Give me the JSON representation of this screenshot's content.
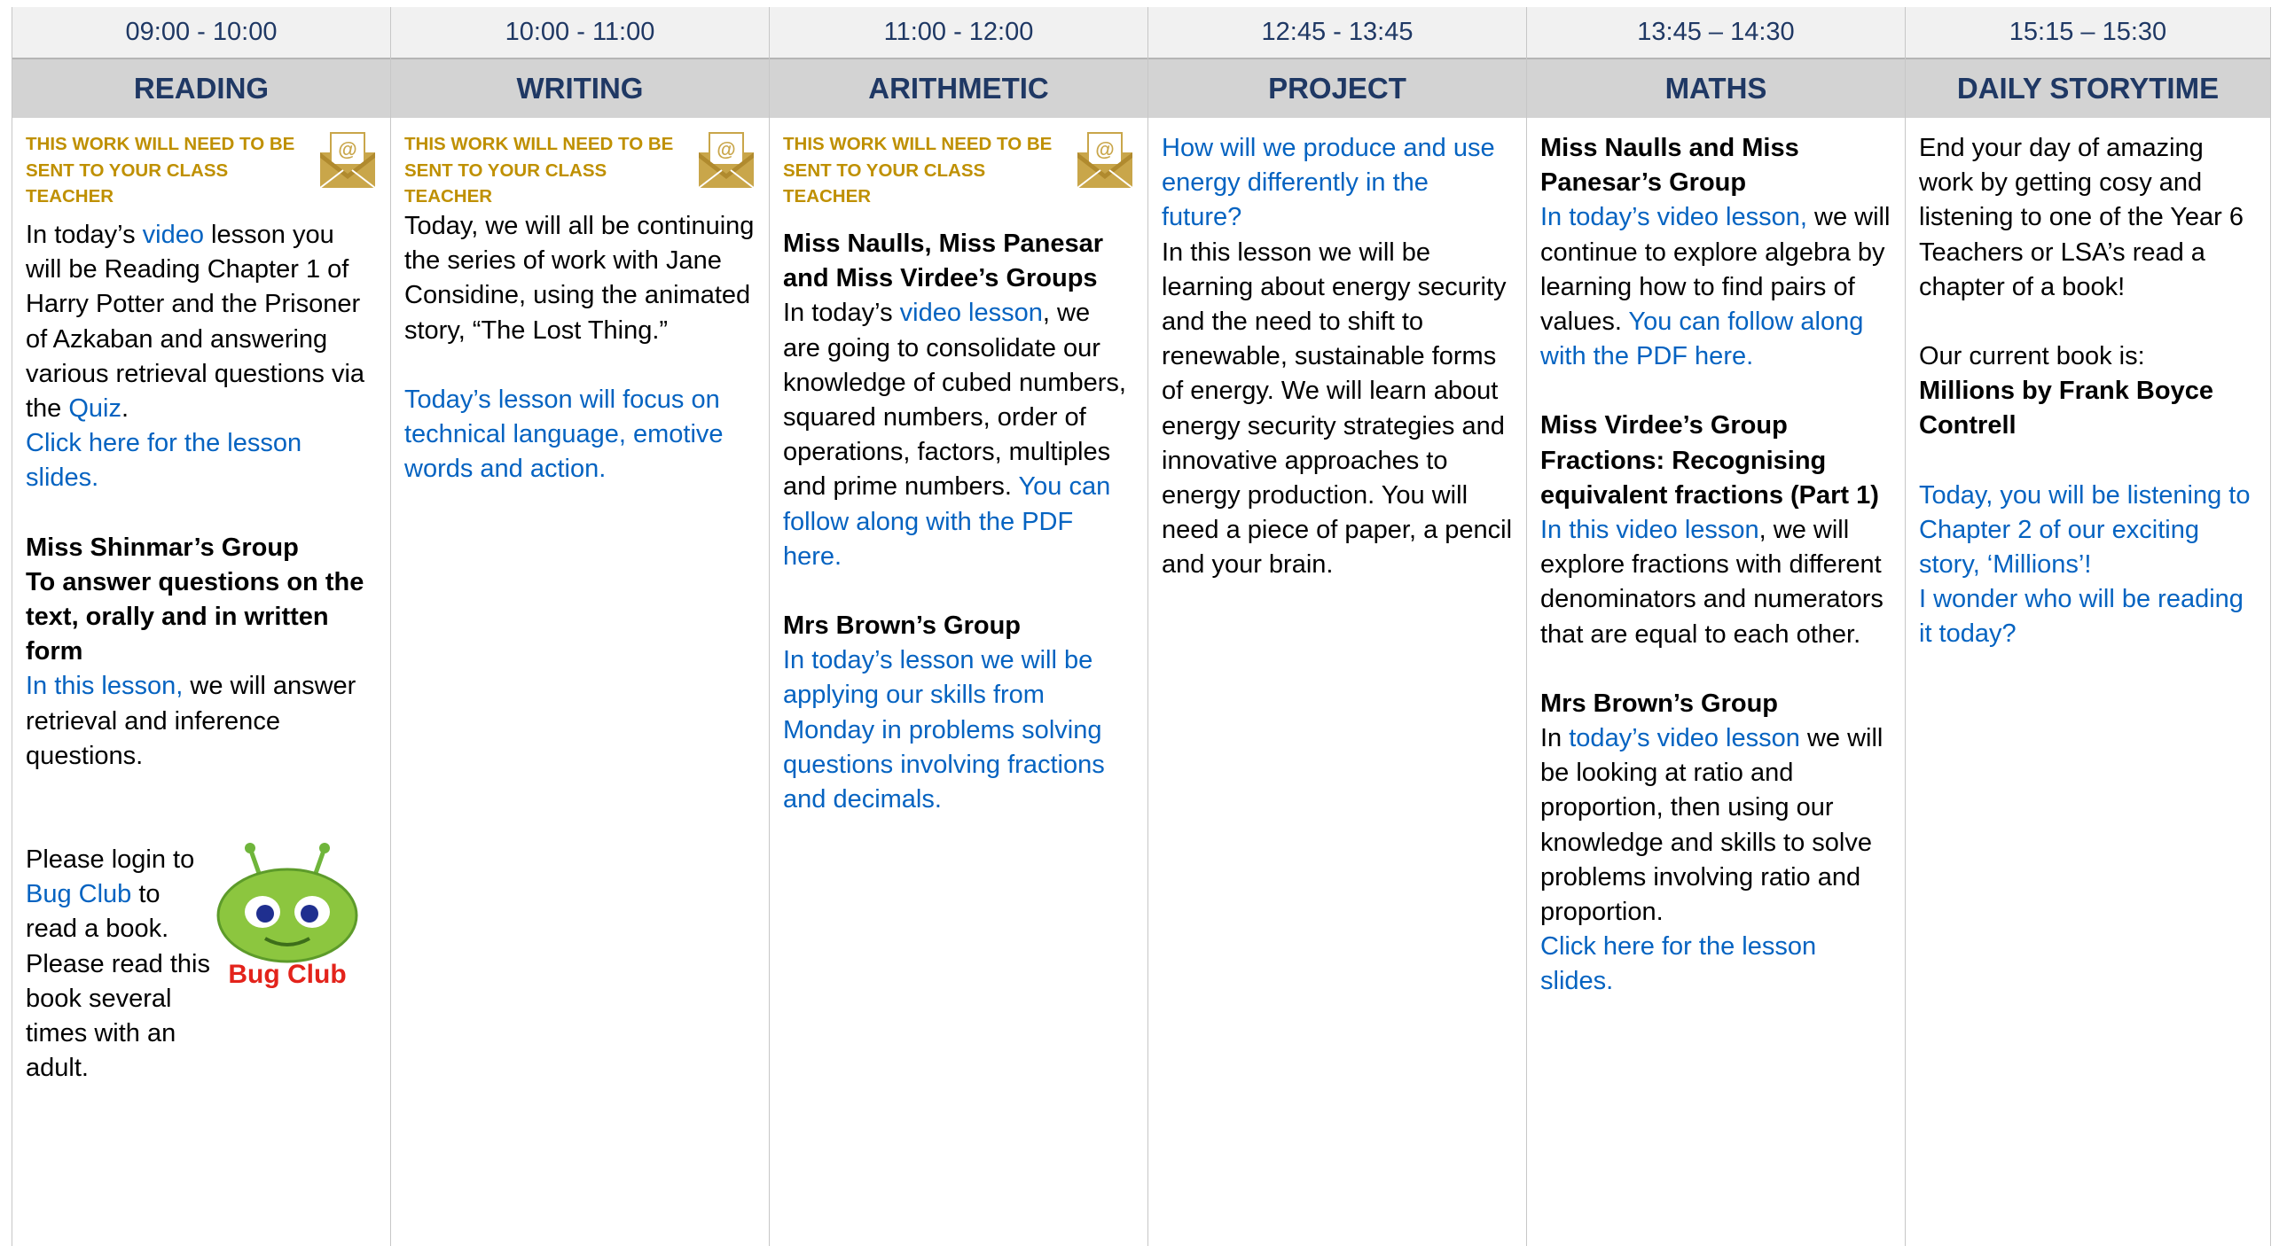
{
  "colors": {
    "header_text": "#1f3864",
    "notice": "#bf9000",
    "link": "#0563c1",
    "subject_bg": "#d3d3d3"
  },
  "icons": {
    "envelope": "email-envelope-icon",
    "bug_club": "bug-club-logo"
  },
  "columns": [
    {
      "time": "09:00 - 10:00",
      "subject": "READING",
      "notice": "THIS WORK WILL NEED TO BE SENT TO YOUR CLASS TEACHER",
      "p1_a": "In today’s ",
      "p1_link": "video",
      "p1_b": " lesson you will be Reading Chapter 1 of Harry Potter and the Prisoner of Azkaban and answering various retrieval questions via the ",
      "p1_link2": "Quiz",
      "p1_c": ".",
      "p2_link": "Click here for the lesson slides.",
      "group_heading": "Miss Shinmar’s Group",
      "group_objective": "To answer questions on the text, orally and in written form",
      "p3_link": "In this lesson,",
      "p3_b": " we will answer retrieval and inference questions.",
      "bug_a": "Please login to ",
      "bug_link": "Bug Club",
      "bug_b": " to read a book. Please read this book several times with an adult.",
      "bug_logo_text": "Bug Club"
    },
    {
      "time": "10:00 - 11:00",
      "subject": "WRITING",
      "notice": "THIS WORK WILL NEED TO BE SENT TO YOUR CLASS TEACHER",
      "p1": "Today, we will all be continuing the series of work with Jane Considine, using the animated story, “The Lost Thing.”",
      "p2_link": "Today’s lesson will focus on technical language, emotive words and action."
    },
    {
      "time": "11:00 - 12:00",
      "subject": "ARITHMETIC",
      "notice": "THIS WORK WILL NEED TO BE SENT TO YOUR CLASS TEACHER",
      "group1_heading": "Miss Naulls, Miss Panesar and Miss Virdee’s Groups",
      "p1_a": "In today’s ",
      "p1_link": "video lesson",
      "p1_b": ", we are going to consolidate our knowledge of cubed numbers, squared numbers, order of operations, factors, multiples and prime numbers.",
      "p1_link2": "You can follow along with the PDF here.",
      "group2_heading": "Mrs Brown’s Group",
      "p2_link": "In today’s lesson we will be applying our skills from Monday in problems solving questions involving fractions and decimals."
    },
    {
      "time": "12:45 - 13:45",
      "subject": "PROJECT",
      "p1_link": "How will we produce and use energy differently in the future?",
      "p1_b": "In this lesson we will be learning about energy security and the need to shift to renewable, sustainable forms of energy. We will learn about energy security strategies and innovative approaches to energy production. You will need a piece of paper, a pencil and your brain."
    },
    {
      "time": "13:45 – 14:30",
      "subject": "MATHS",
      "group1_heading": "Miss Naulls and Miss Panesar’s Group",
      "p1_link": "In today’s video lesson,",
      "p1_b": " we will continue to explore algebra by learning how to find pairs of values. ",
      "p1_link2": "You can follow along with the PDF here.",
      "group2_heading": "Miss Virdee’s Group",
      "group2_title": "Fractions: Recognising equivalent fractions (Part 1)",
      "p2_link": "In this video lesson",
      "p2_b": ", we will explore fractions with different denominators and numerators that are equal to each other.",
      "group3_heading": "Mrs Brown’s Group",
      "p3_a": "In ",
      "p3_link": "today’s video lesson",
      "p3_b": " we will be looking at ratio and proportion, then using our knowledge and skills to solve problems involving ratio and proportion.",
      "p3_link2": "Click here for the lesson slides."
    },
    {
      "time": "15:15 – 15:30",
      "subject": "DAILY STORYTIME",
      "p1": "End your day of amazing work by getting cosy and listening to one of the Year 6 Teachers or LSA’s read a chapter of a book!",
      "p2_label": "Our current book is:",
      "p2_book": "Millions by Frank Boyce Contrell",
      "p3_link": "Today, you will be listening to Chapter 2 of our exciting story, ‘Millions’!",
      "p3_link2": "I wonder who will be reading it today?"
    }
  ]
}
